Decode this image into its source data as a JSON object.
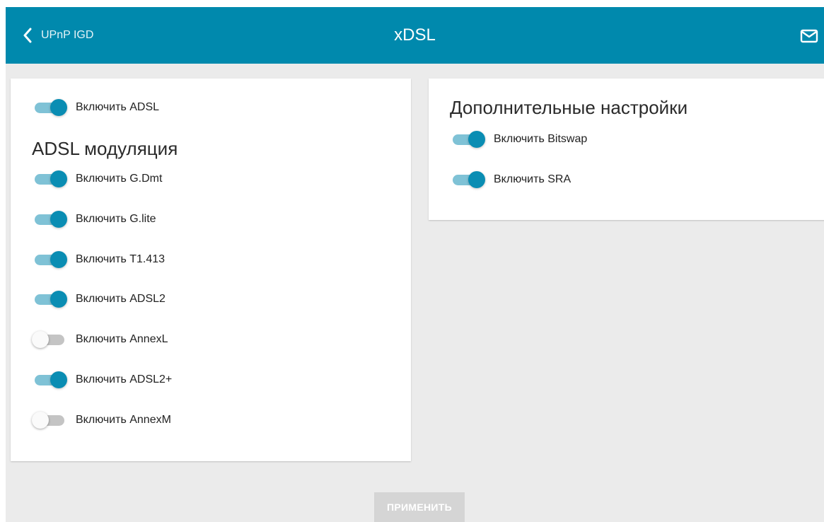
{
  "header": {
    "back_label": "UPnP IGD",
    "title": "xDSL",
    "mail_icon": "mail-icon"
  },
  "left_card": {
    "enable_adsl": {
      "label": "Включить ADSL",
      "on": true
    },
    "modulation_title": "ADSL модуляция",
    "items": [
      {
        "label": "Включить G.Dmt",
        "on": true
      },
      {
        "label": "Включить G.lite",
        "on": true
      },
      {
        "label": "Включить T1.413",
        "on": true
      },
      {
        "label": "Включить ADSL2",
        "on": true
      },
      {
        "label": "Включить AnnexL",
        "on": false
      },
      {
        "label": "Включить ADSL2+",
        "on": true
      },
      {
        "label": "Включить AnnexM",
        "on": false
      }
    ]
  },
  "right_card": {
    "title": "Дополнительные настройки",
    "items": [
      {
        "label": "Включить Bitswap",
        "on": true
      },
      {
        "label": "Включить SRA",
        "on": true
      }
    ]
  },
  "apply_label": "ПРИМЕНИТЬ",
  "colors": {
    "header_bg": "#0089ad",
    "switch_on": "#0a8db3",
    "switch_track_on": "#7fc2d6",
    "switch_off": "#c4c4c4",
    "apply_disabled": "#d5d5d5"
  }
}
